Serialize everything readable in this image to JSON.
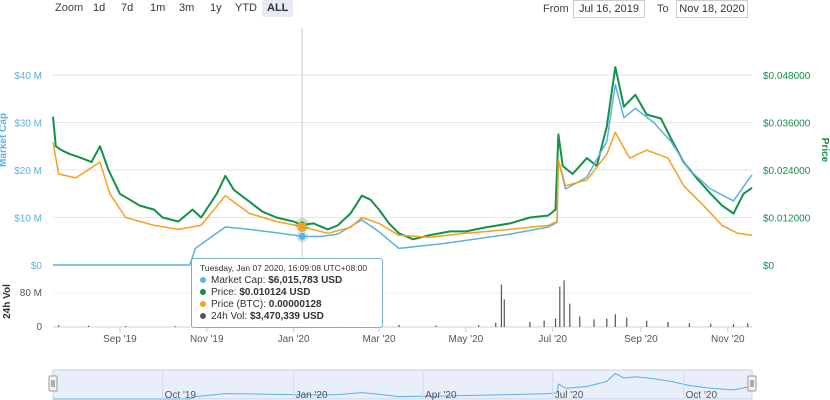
{
  "toolbar": {
    "zoom_label": "Zoom",
    "buttons": [
      "1d",
      "7d",
      "1m",
      "3m",
      "1y",
      "YTD",
      "ALL"
    ],
    "active": "ALL",
    "from_label": "From",
    "from_value": "Jul 16, 2019",
    "to_label": "To",
    "to_value": "Nov 18, 2020"
  },
  "tooltip": {
    "header": "Tuesday, Jan 07 2020, 16:09:08 UTC+08:00",
    "rows": [
      {
        "label": "Market Cap:",
        "value": "$6,015,783 USD",
        "color": "#5bb1e0"
      },
      {
        "label": "Price:",
        "value": "$0.010124 USD",
        "color": "#14904a"
      },
      {
        "label": "Price (BTC):",
        "value": "0.00000128",
        "color": "#f7a01c"
      },
      {
        "label": "24h Vol:",
        "value": "$3,470,339 USD",
        "color": "#555555"
      }
    ]
  },
  "chart_data": {
    "type": "line",
    "x_range": [
      "2019-07-16",
      "2020-11-18"
    ],
    "x_ticks": [
      {
        "date": "2019-09-01",
        "label": "Sep '19"
      },
      {
        "date": "2019-11-01",
        "label": "Nov '19"
      },
      {
        "date": "2020-01-01",
        "label": "Jan '20"
      },
      {
        "date": "2020-03-01",
        "label": "Mar '20"
      },
      {
        "date": "2020-05-01",
        "label": "May '20"
      },
      {
        "date": "2020-07-01",
        "label": "Jul '20"
      },
      {
        "date": "2020-09-01",
        "label": "Sep '20"
      },
      {
        "date": "2020-11-01",
        "label": "Nov '20"
      }
    ],
    "navigator_ticks": [
      {
        "date": "2019-10-01",
        "label": "Oct '19"
      },
      {
        "date": "2020-01-01",
        "label": "Jan '20"
      },
      {
        "date": "2020-04-01",
        "label": "Apr '20"
      },
      {
        "date": "2020-07-01",
        "label": "Jul '20"
      },
      {
        "date": "2020-10-01",
        "label": "Oct '20"
      }
    ],
    "left_axis": {
      "label": "Market Cap",
      "ylim": [
        0,
        40000000
      ],
      "ticks": [
        {
          "v": 0,
          "t": "$0"
        },
        {
          "v": 10000000,
          "t": "$10 M"
        },
        {
          "v": 20000000,
          "t": "$20 M"
        },
        {
          "v": 30000000,
          "t": "$30 M"
        },
        {
          "v": 40000000,
          "t": "$40 M"
        }
      ]
    },
    "right_axis": {
      "label": "Price",
      "ylim": [
        0,
        0.048
      ],
      "ticks": [
        {
          "v": 0,
          "t": "$0"
        },
        {
          "v": 0.012,
          "t": "$0.012000"
        },
        {
          "v": 0.024,
          "t": "$0.024000"
        },
        {
          "v": 0.036,
          "t": "$0.036000"
        },
        {
          "v": 0.048,
          "t": "$0.048000"
        }
      ]
    },
    "volume_axis": {
      "label": "24h Vol",
      "ylim": [
        0,
        120000000
      ],
      "ticks": [
        {
          "v": 0,
          "t": "0"
        },
        {
          "v": 80000000,
          "t": "80 M"
        }
      ]
    },
    "series": [
      {
        "name": "Price",
        "axis": "right",
        "color": "#14904a",
        "points": [
          [
            "2019-07-16",
            0.0375
          ],
          [
            "2019-07-18",
            0.03
          ],
          [
            "2019-07-22",
            0.029
          ],
          [
            "2019-07-28",
            0.028
          ],
          [
            "2019-08-05",
            0.027
          ],
          [
            "2019-08-12",
            0.026
          ],
          [
            "2019-08-18",
            0.03
          ],
          [
            "2019-08-24",
            0.024
          ],
          [
            "2019-09-01",
            0.018
          ],
          [
            "2019-09-15",
            0.015
          ],
          [
            "2019-09-25",
            0.014
          ],
          [
            "2019-10-01",
            0.012
          ],
          [
            "2019-10-12",
            0.011
          ],
          [
            "2019-10-22",
            0.014
          ],
          [
            "2019-10-28",
            0.012
          ],
          [
            "2019-11-08",
            0.018
          ],
          [
            "2019-11-14",
            0.0225
          ],
          [
            "2019-11-20",
            0.019
          ],
          [
            "2019-12-01",
            0.016
          ],
          [
            "2019-12-10",
            0.0135
          ],
          [
            "2019-12-20",
            0.012
          ],
          [
            "2020-01-01",
            0.011
          ],
          [
            "2020-01-07",
            0.0101
          ],
          [
            "2020-01-15",
            0.0105
          ],
          [
            "2020-01-25",
            0.009
          ],
          [
            "2020-02-01",
            0.01
          ],
          [
            "2020-02-10",
            0.013
          ],
          [
            "2020-02-18",
            0.0175
          ],
          [
            "2020-02-24",
            0.0165
          ],
          [
            "2020-03-01",
            0.014
          ],
          [
            "2020-03-08",
            0.0105
          ],
          [
            "2020-03-15",
            0.008
          ],
          [
            "2020-03-25",
            0.0065
          ],
          [
            "2020-04-05",
            0.0075
          ],
          [
            "2020-04-20",
            0.0085
          ],
          [
            "2020-05-01",
            0.0085
          ],
          [
            "2020-05-15",
            0.0095
          ],
          [
            "2020-06-01",
            0.0105
          ],
          [
            "2020-06-15",
            0.012
          ],
          [
            "2020-06-28",
            0.0125
          ],
          [
            "2020-07-03",
            0.014
          ],
          [
            "2020-07-05",
            0.033
          ],
          [
            "2020-07-08",
            0.025
          ],
          [
            "2020-07-15",
            0.023
          ],
          [
            "2020-07-25",
            0.027
          ],
          [
            "2020-08-01",
            0.025
          ],
          [
            "2020-08-08",
            0.035
          ],
          [
            "2020-08-14",
            0.05
          ],
          [
            "2020-08-20",
            0.04
          ],
          [
            "2020-08-28",
            0.043
          ],
          [
            "2020-09-05",
            0.038
          ],
          [
            "2020-09-15",
            0.037
          ],
          [
            "2020-09-22",
            0.032
          ],
          [
            "2020-10-01",
            0.026
          ],
          [
            "2020-10-10",
            0.022
          ],
          [
            "2020-10-20",
            0.018
          ],
          [
            "2020-10-28",
            0.015
          ],
          [
            "2020-11-05",
            0.013
          ],
          [
            "2020-11-12",
            0.018
          ],
          [
            "2020-11-18",
            0.0195
          ]
        ]
      },
      {
        "name": "Market Cap",
        "axis": "left",
        "color": "#5bb1e0",
        "points": [
          [
            "2019-07-16",
            0
          ],
          [
            "2019-10-20",
            0
          ],
          [
            "2019-10-24",
            3500000
          ],
          [
            "2019-11-14",
            8000000
          ],
          [
            "2019-12-01",
            7500000
          ],
          [
            "2019-12-20",
            6800000
          ],
          [
            "2020-01-07",
            6015783
          ],
          [
            "2020-01-20",
            6000000
          ],
          [
            "2020-02-01",
            6500000
          ],
          [
            "2020-02-18",
            9500000
          ],
          [
            "2020-03-01",
            7000000
          ],
          [
            "2020-03-15",
            3500000
          ],
          [
            "2020-04-15",
            4500000
          ],
          [
            "2020-06-01",
            6500000
          ],
          [
            "2020-06-28",
            8000000
          ],
          [
            "2020-07-04",
            9000000
          ],
          [
            "2020-07-05",
            22000000
          ],
          [
            "2020-07-10",
            16000000
          ],
          [
            "2020-07-25",
            18500000
          ],
          [
            "2020-08-08",
            26000000
          ],
          [
            "2020-08-14",
            38000000
          ],
          [
            "2020-08-20",
            31000000
          ],
          [
            "2020-08-28",
            33000000
          ],
          [
            "2020-09-10",
            30000000
          ],
          [
            "2020-09-22",
            26000000
          ],
          [
            "2020-10-05",
            20000000
          ],
          [
            "2020-10-20",
            16000000
          ],
          [
            "2020-11-05",
            13500000
          ],
          [
            "2020-11-12",
            16500000
          ],
          [
            "2020-11-18",
            19000000
          ]
        ]
      },
      {
        "name": "Price (BTC)",
        "axis": "right",
        "color": "#f7a01c",
        "points": [
          [
            "2019-07-16",
            0.031
          ],
          [
            "2019-07-20",
            0.023
          ],
          [
            "2019-08-01",
            0.022
          ],
          [
            "2019-08-18",
            0.026
          ],
          [
            "2019-08-25",
            0.018
          ],
          [
            "2019-09-05",
            0.012
          ],
          [
            "2019-09-25",
            0.01
          ],
          [
            "2019-10-12",
            0.009
          ],
          [
            "2019-10-28",
            0.01
          ],
          [
            "2019-11-14",
            0.0175
          ],
          [
            "2019-12-01",
            0.013
          ],
          [
            "2019-12-20",
            0.011
          ],
          [
            "2020-01-07",
            0.0097
          ],
          [
            "2020-01-25",
            0.008
          ],
          [
            "2020-02-10",
            0.0095
          ],
          [
            "2020-02-18",
            0.012
          ],
          [
            "2020-03-01",
            0.0105
          ],
          [
            "2020-03-15",
            0.0075
          ],
          [
            "2020-04-05",
            0.007
          ],
          [
            "2020-05-01",
            0.008
          ],
          [
            "2020-06-01",
            0.009
          ],
          [
            "2020-06-28",
            0.01
          ],
          [
            "2020-07-04",
            0.011
          ],
          [
            "2020-07-05",
            0.0265
          ],
          [
            "2020-07-10",
            0.02
          ],
          [
            "2020-07-25",
            0.0215
          ],
          [
            "2020-08-08",
            0.028
          ],
          [
            "2020-08-14",
            0.0335
          ],
          [
            "2020-08-24",
            0.027
          ],
          [
            "2020-09-05",
            0.029
          ],
          [
            "2020-09-20",
            0.027
          ],
          [
            "2020-10-01",
            0.02
          ],
          [
            "2020-10-15",
            0.015
          ],
          [
            "2020-10-28",
            0.01
          ],
          [
            "2020-11-08",
            0.008
          ],
          [
            "2020-11-18",
            0.0075
          ]
        ]
      },
      {
        "name": "24h Vol",
        "axis": "volume",
        "color": "#555555",
        "type": "bar",
        "points": [
          [
            "2019-07-20",
            4000000
          ],
          [
            "2019-08-10",
            3000000
          ],
          [
            "2019-09-05",
            2500000
          ],
          [
            "2019-10-10",
            2000000
          ],
          [
            "2019-11-10",
            3000000
          ],
          [
            "2019-12-10",
            2500000
          ],
          [
            "2020-01-07",
            3470339
          ],
          [
            "2020-02-05",
            3000000
          ],
          [
            "2020-02-20",
            8000000
          ],
          [
            "2020-03-15",
            5000000
          ],
          [
            "2020-04-10",
            3500000
          ],
          [
            "2020-05-10",
            4000000
          ],
          [
            "2020-05-22",
            10000000
          ],
          [
            "2020-05-26",
            100000000
          ],
          [
            "2020-05-28",
            65000000
          ],
          [
            "2020-06-15",
            12000000
          ],
          [
            "2020-06-25",
            15000000
          ],
          [
            "2020-07-03",
            20000000
          ],
          [
            "2020-07-06",
            95000000
          ],
          [
            "2020-07-09",
            110000000
          ],
          [
            "2020-07-13",
            55000000
          ],
          [
            "2020-07-20",
            25000000
          ],
          [
            "2020-07-30",
            18000000
          ],
          [
            "2020-08-08",
            20000000
          ],
          [
            "2020-08-14",
            30000000
          ],
          [
            "2020-08-22",
            22000000
          ],
          [
            "2020-09-05",
            15000000
          ],
          [
            "2020-09-20",
            12000000
          ],
          [
            "2020-10-05",
            9000000
          ],
          [
            "2020-10-20",
            8000000
          ],
          [
            "2020-11-05",
            7000000
          ],
          [
            "2020-11-15",
            9000000
          ]
        ]
      }
    ],
    "crosshair_date": "2020-01-07",
    "grid": true
  }
}
